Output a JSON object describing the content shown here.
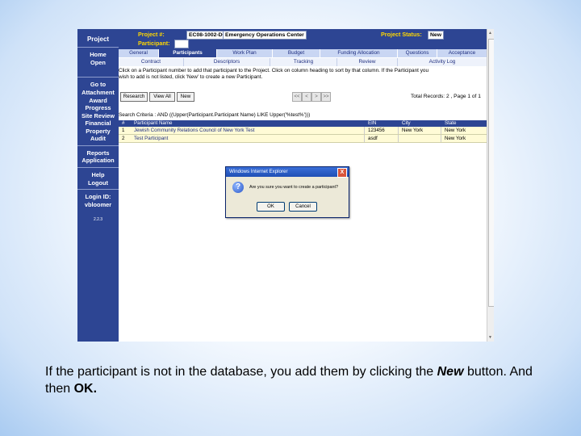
{
  "nav": {
    "project": "Project",
    "home": "Home",
    "open": "Open",
    "goto": "Go to",
    "attachment": "Attachment",
    "award": "Award",
    "progress": "Progress",
    "site_review": "Site Review",
    "financial": "Financial",
    "property": "Property",
    "audit": "Audit",
    "reports": "Reports",
    "application": "Application",
    "help": "Help",
    "logout": "Logout",
    "login_id_label": "Login ID:",
    "login_id": "vbloomer",
    "version": "2.2.3"
  },
  "header": {
    "project_no_label": "Project #:",
    "project_no": "EC08-1002-D00",
    "project_name": "Emergency Operations Center",
    "participant_label": "Participant:",
    "participant": "",
    "status_label": "Project Status:",
    "status": "New"
  },
  "tabs_row1": [
    "General",
    "Participants",
    "Work Plan",
    "Budget",
    "Funding Allocation",
    "Questions",
    "Acceptance"
  ],
  "tabs_row2": [
    "Contract",
    "Descriptors",
    "Tracking",
    "Review",
    "Activity Log"
  ],
  "instructions": {
    "line1": "Click on a Participant number to add that participant to the Project. Click on column heading to sort by that column. If the Participant you",
    "line2": "wish to add is not listed, click 'New' to create a new Participant."
  },
  "toolbar": {
    "research": "Research",
    "view_all": "View All",
    "new": "New",
    "first": "<<",
    "prev": "<",
    "next": ">",
    "last": ">>",
    "records": "Total Records: 2 , Page 1 of 1"
  },
  "search_criteria": "Search Criteria : AND ((Upper(Participant.Participant Name) LIKE Upper('%test%')))",
  "table": {
    "headers": [
      "#",
      "Participant Name",
      "EIN",
      "City",
      "State"
    ],
    "rows": [
      [
        "1",
        "Jewish Community Relations Council of New York Test",
        "123456",
        "New York",
        "New York"
      ],
      [
        "2",
        "Test Participant",
        "asdf",
        "",
        "New York"
      ]
    ]
  },
  "dialog": {
    "title": "Windows Internet Explorer",
    "message": "Are you sure you want to create a participant?",
    "ok": "OK",
    "cancel": "Cancel",
    "close": "X"
  },
  "caption": {
    "part1": "If the participant is not in the database, you add them by clicking the ",
    "new_word": "New",
    "part2": " button. And then ",
    "ok_word": "OK."
  },
  "colors": {
    "nav_blue": "#2d4593",
    "label_yellow": "#ffd700",
    "row_yellow": "#fffbd6"
  }
}
